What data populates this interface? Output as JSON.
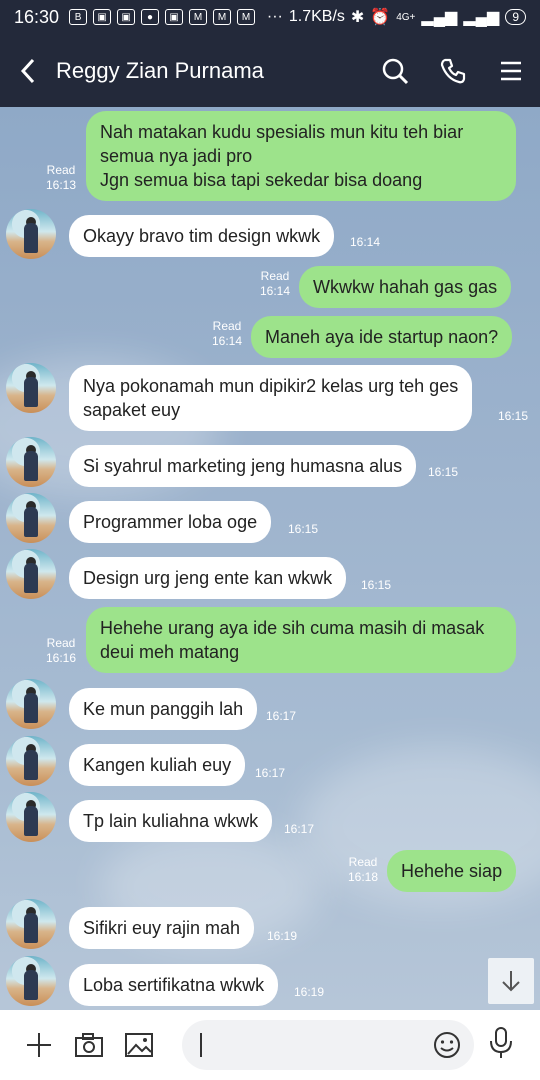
{
  "status_bar": {
    "time": "16:30",
    "network_speed": "1.7KB/s",
    "battery": "9",
    "network_type": "4G+"
  },
  "header": {
    "contact_name": "Reggy Zian Purnama"
  },
  "messages": [
    {
      "dir": "out",
      "lines": [
        "Nah matakan kudu spesialis mun kitu teh biar",
        "semua nya jadi pro",
        "Jgn semua bisa tapi sekedar bisa doang"
      ],
      "read": "Read",
      "time": "16:13"
    },
    {
      "dir": "in",
      "lines": [
        "Okayy bravo tim design wkwk"
      ],
      "time": "16:14"
    },
    {
      "dir": "out",
      "lines": [
        "Wkwkw hahah gas gas"
      ],
      "read": "Read",
      "time": "16:14"
    },
    {
      "dir": "out",
      "lines": [
        "Maneh aya ide startup naon?"
      ],
      "read": "Read",
      "time": "16:14"
    },
    {
      "dir": "in",
      "lines": [
        "Nya pokonamah mun dipikir2 kelas urg teh ges",
        "sapaket euy"
      ],
      "time": "16:15"
    },
    {
      "dir": "in",
      "lines": [
        "Si syahrul marketing jeng humasna alus"
      ],
      "time": "16:15"
    },
    {
      "dir": "in",
      "lines": [
        "Programmer loba oge"
      ],
      "time": "16:15"
    },
    {
      "dir": "in",
      "lines": [
        "Design urg jeng ente kan wkwk"
      ],
      "time": "16:15"
    },
    {
      "dir": "out",
      "lines": [
        "Hehehe urang aya ide sih cuma masih di masak",
        "deui meh matang"
      ],
      "read": "Read",
      "time": "16:16"
    },
    {
      "dir": "in",
      "lines": [
        "Ke mun panggih lah"
      ],
      "time": "16:17"
    },
    {
      "dir": "in",
      "lines": [
        "Kangen kuliah euy"
      ],
      "time": "16:17"
    },
    {
      "dir": "in",
      "lines": [
        "Tp lain kuliahna wkwk"
      ],
      "time": "16:17"
    },
    {
      "dir": "out",
      "lines": [
        "Hehehe siap"
      ],
      "read": "Read",
      "time": "16:18"
    },
    {
      "dir": "in",
      "lines": [
        "Sifikri euy rajin mah"
      ],
      "time": "16:19"
    },
    {
      "dir": "in",
      "lines": [
        "Loba sertifikatna wkwk"
      ],
      "time": "16:19"
    }
  ],
  "icons": {
    "header": [
      "back-arrow-icon",
      "search-icon",
      "phone-icon",
      "menu-icon"
    ],
    "input_bar": [
      "plus-icon",
      "camera-icon",
      "image-icon",
      "emoji-icon",
      "microphone-icon"
    ],
    "chat": [
      "scroll-down-arrow-icon"
    ]
  },
  "colors": {
    "header_bg": "#23293a",
    "outgoing_bubble": "#9de38b",
    "incoming_bubble": "#ffffff"
  }
}
